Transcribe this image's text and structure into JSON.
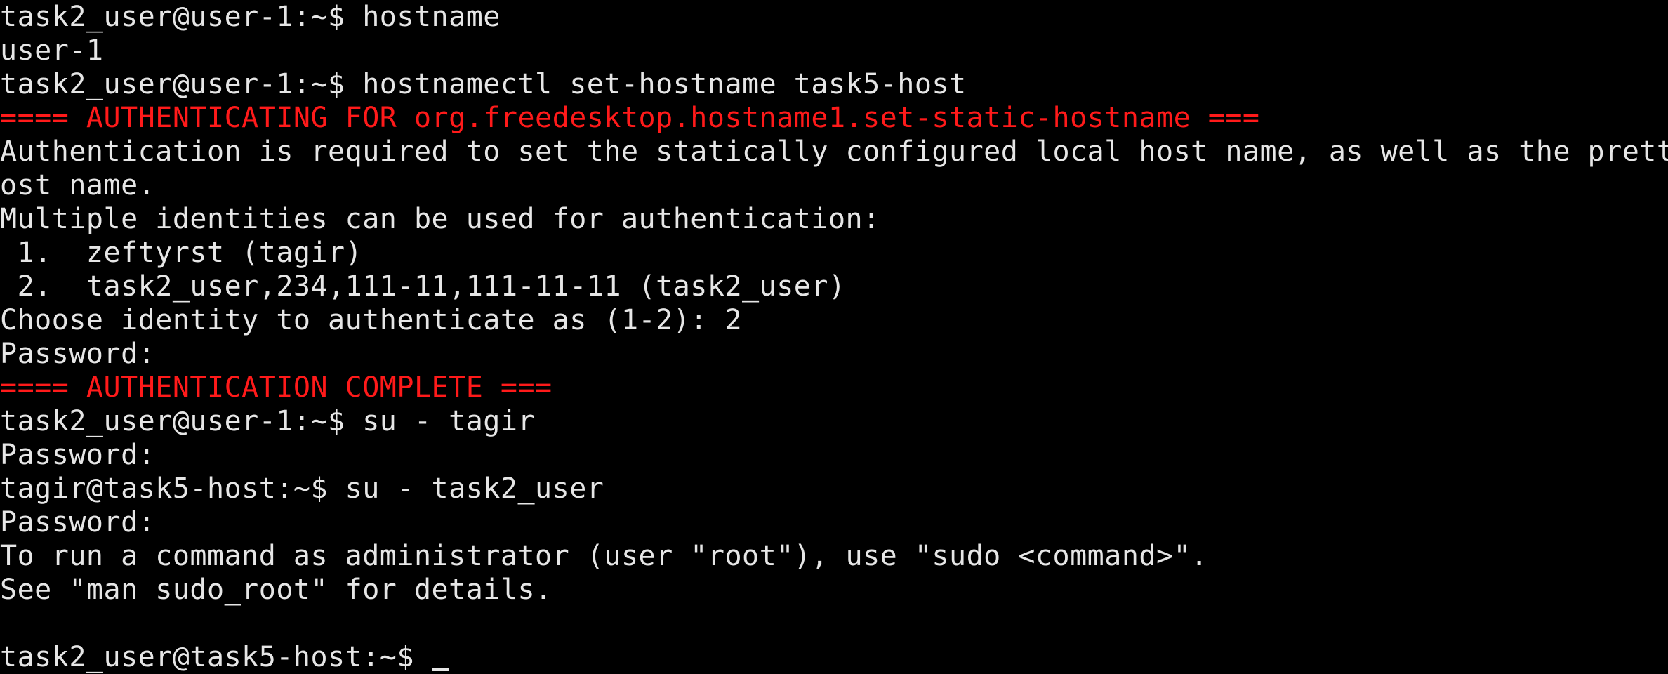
{
  "terminal": {
    "lines": [
      {
        "text": "task2_user@user-1:~$ hostname",
        "color": "#e6e6e6"
      },
      {
        "text": "user-1",
        "color": "#e6e6e6"
      },
      {
        "text": "task2_user@user-1:~$ hostnamectl set-hostname task5-host",
        "color": "#e6e6e6"
      },
      {
        "text": "==== AUTHENTICATING FOR org.freedesktop.hostname1.set-static-hostname ===",
        "color": "#ff1a1a"
      },
      {
        "text": "Authentication is required to set the statically configured local host name, as well as the pretty",
        "color": "#e6e6e6"
      },
      {
        "text": "ost name.",
        "color": "#e6e6e6"
      },
      {
        "text": "Multiple identities can be used for authentication:",
        "color": "#e6e6e6"
      },
      {
        "text": " 1.  zeftyrst (tagir)",
        "color": "#e6e6e6"
      },
      {
        "text": " 2.  task2_user,234,111-11,111-11-11 (task2_user)",
        "color": "#e6e6e6"
      },
      {
        "text": "Choose identity to authenticate as (1-2): 2",
        "color": "#e6e6e6"
      },
      {
        "text": "Password:",
        "color": "#e6e6e6"
      },
      {
        "text": "==== AUTHENTICATION COMPLETE ===",
        "color": "#ff1a1a"
      },
      {
        "text": "task2_user@user-1:~$ su - tagir",
        "color": "#e6e6e6"
      },
      {
        "text": "Password:",
        "color": "#e6e6e6"
      },
      {
        "text": "tagir@task5-host:~$ su - task2_user",
        "color": "#e6e6e6"
      },
      {
        "text": "Password:",
        "color": "#e6e6e6"
      },
      {
        "text": "To run a command as administrator (user \"root\"), use \"sudo <command>\".",
        "color": "#e6e6e6"
      },
      {
        "text": "See \"man sudo_root\" for details.",
        "color": "#e6e6e6"
      },
      {
        "text": "",
        "color": "#e6e6e6"
      }
    ],
    "prompt": "task2_user@task5-host:~$ "
  }
}
